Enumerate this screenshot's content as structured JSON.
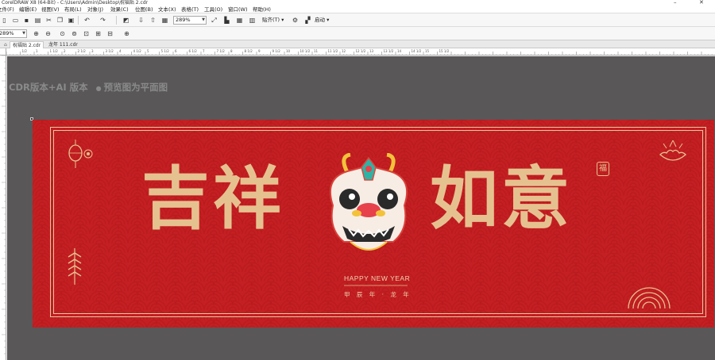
{
  "window": {
    "title": "CorelDRAW X8 (64-Bit) - C:\\Users\\Admin\\Desktop\\祝福贴 2.cdr",
    "minimize": "–",
    "close": "✕"
  },
  "menu": [
    "文件(F)",
    "编辑(E)",
    "视图(V)",
    "布局(L)",
    "对象(J)",
    "效果(C)",
    "位图(B)",
    "文本(X)",
    "表格(T)",
    "工具(O)",
    "窗口(W)",
    "帮助(H)"
  ],
  "toolbar": {
    "zoom_value": "289%",
    "snap_label": "贴齐(T)",
    "launch_label": "启动"
  },
  "toolbar2": {
    "zoom_value": "289%"
  },
  "tabs": [
    {
      "label": "祝福贴 2.cdr"
    },
    {
      "label": "龙年 111.cdr"
    }
  ],
  "ruler": {
    "marks": [
      "1/2",
      "1",
      "1 1/2",
      "2",
      "2 1/2",
      "3",
      "3 1/2",
      "4",
      "4 1/2",
      "5",
      "5 1/2",
      "6",
      "6 1/2",
      "7",
      "7 1/2",
      "8",
      "8 1/2",
      "9",
      "9 1/2",
      "10",
      "10 1/2",
      "11",
      "11 1/2",
      "12",
      "12 1/2",
      "13",
      "13 1/2",
      "14",
      "14 1/2",
      "15",
      "15 1/2"
    ]
  },
  "canvas": {
    "version_note": "CDR版本+AI 版本",
    "preview_note": "预览图为平面图"
  },
  "design": {
    "left_words": "吉祥",
    "right_words": "如意",
    "subtitle_en": "HAPPY NEW YEAR",
    "subtitle_cn": "甲 辰 年 · 龙 年",
    "seal": "福",
    "colors": {
      "background": "#c41f22",
      "gold": "#e6c190"
    }
  }
}
